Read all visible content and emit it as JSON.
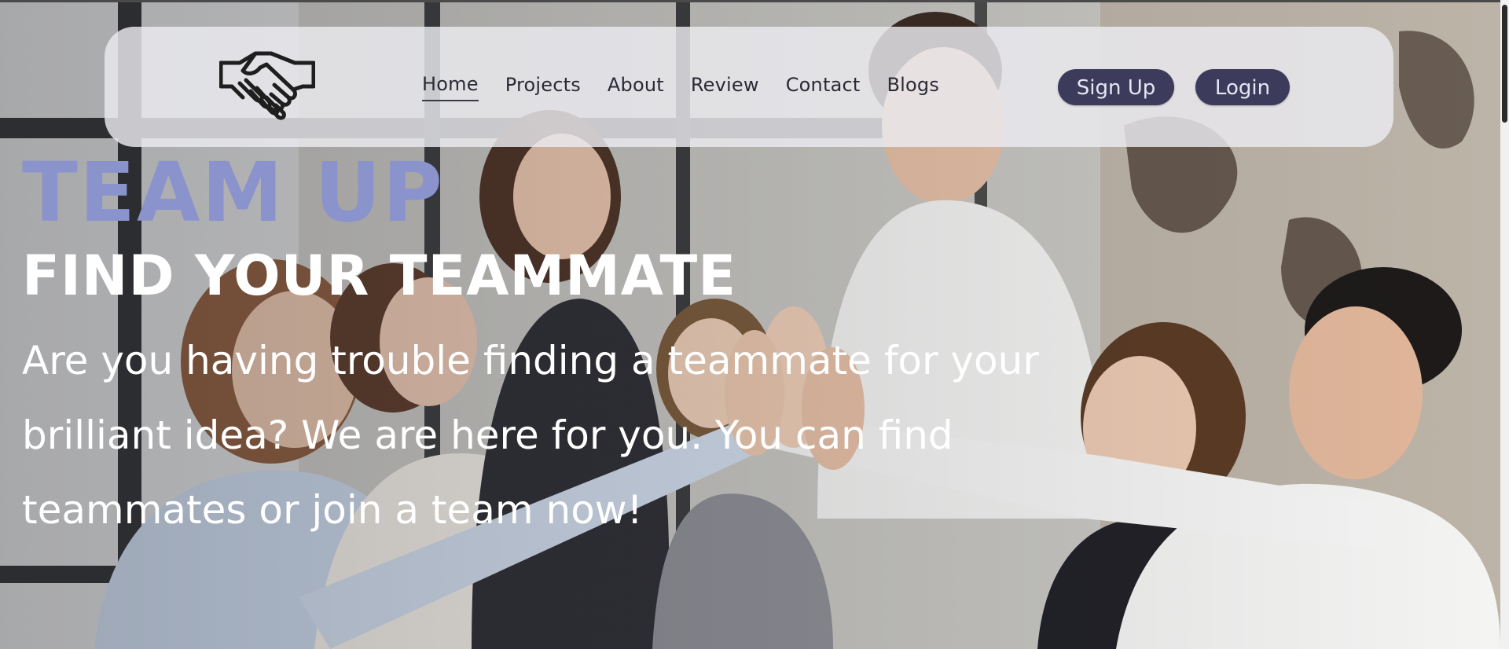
{
  "nav": {
    "logo_icon": "handshake-icon",
    "links": [
      {
        "label": "Home",
        "active": true
      },
      {
        "label": "Projects",
        "active": false
      },
      {
        "label": "About",
        "active": false
      },
      {
        "label": "Review",
        "active": false
      },
      {
        "label": "Contact",
        "active": false
      },
      {
        "label": "Blogs",
        "active": false
      }
    ],
    "signup_label": "Sign Up",
    "login_label": "Login"
  },
  "hero": {
    "headline": "TEAM UP",
    "subheadline": "FIND YOUR TEAMMATE",
    "body": "Are you having trouble finding a teammate for your brilliant idea? We are here for you. You can find teammates or join a team now!",
    "background_description": "team-high-five-photo"
  },
  "colors": {
    "headline": "#8a93cc",
    "subheadline": "#ffffff",
    "button_bg": "#3d3b5c",
    "button_text": "#e6e6f2",
    "navbar_bg": "rgba(236,236,240,0.82)"
  }
}
